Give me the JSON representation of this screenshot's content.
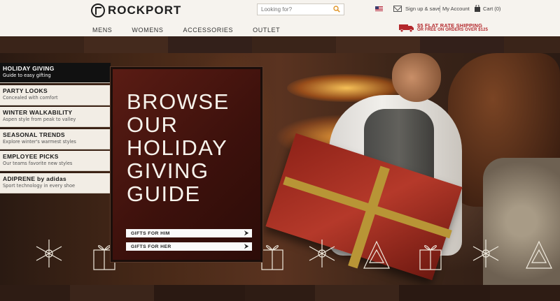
{
  "header": {
    "logo_text": "ROCKPORT",
    "search": {
      "placeholder": "Looking for?"
    },
    "utility": {
      "signup_label": "Sign up & save",
      "account_label": "My Account",
      "cart_label": "Cart (0)"
    },
    "nav": [
      "MENS",
      "WOMENS",
      "ACCESSORIES",
      "OUTLET"
    ],
    "shipping": {
      "line1": "$5 FLAT RATE SHIPPING",
      "line2": "OR FREE ON ORDERS OVER $125",
      "color": "#b3272b"
    }
  },
  "sidebar": {
    "items": [
      {
        "title": "HOLIDAY GIVING",
        "subtitle": "Guide to easy gifting",
        "active": true
      },
      {
        "title": "PARTY LOOKS",
        "subtitle": "Concealed with comfort",
        "active": false
      },
      {
        "title": "WINTER WALKABILITY",
        "subtitle": "Aspen style from peak to valley",
        "active": false
      },
      {
        "title": "SEASONAL TRENDS",
        "subtitle": "Explore winter's warmest styles",
        "active": false
      },
      {
        "title": "EMPLOYEE PICKS",
        "subtitle": "Our teams favorite new styles",
        "active": false
      },
      {
        "title": "ADIPRENE by adidas",
        "subtitle": "Sport technology in every shoe",
        "active": false
      }
    ]
  },
  "promo": {
    "heading": "BROWSE\nOUR\nHOLIDAY\nGIVING\nGUIDE",
    "buttons": [
      {
        "label": "GIFTS FOR HIM",
        "arrow": "⮞"
      },
      {
        "label": "GIFTS FOR HER",
        "arrow": "⮞"
      }
    ]
  },
  "icons": {
    "logo": "rockport-logo-icon",
    "search": "magnifier-icon",
    "flag": "us-flag-icon",
    "envelope": "envelope-icon",
    "cart": "shopping-bag-icon",
    "truck": "delivery-truck-icon"
  }
}
